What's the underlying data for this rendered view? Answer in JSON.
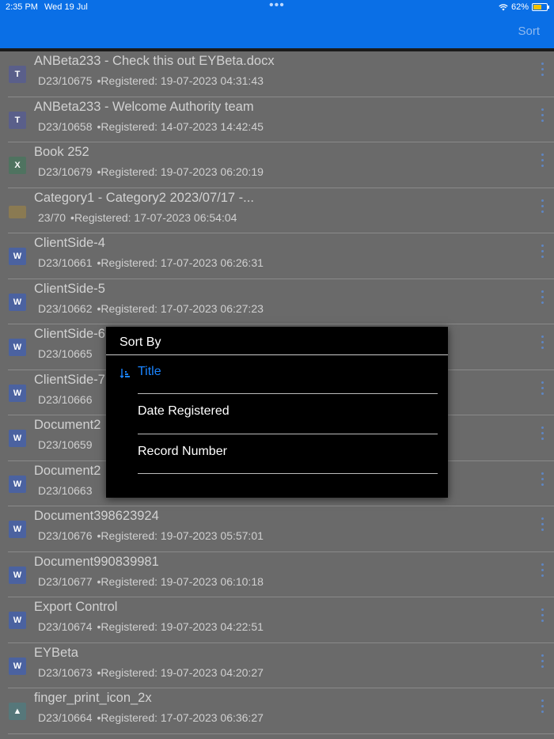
{
  "status": {
    "time": "2:35 PM",
    "date": "Wed 19 Jul",
    "dots": "•••",
    "battery": "62%"
  },
  "header": {
    "sort_label": "Sort"
  },
  "items": [
    {
      "title": "ANBeta233 - Check this out  EYBeta.docx",
      "number": "D23/10675",
      "registered": "•Registered: 19-07-2023 04:31:43",
      "icon": "teams-file-icon"
    },
    {
      "title": "ANBeta233 - Welcome Authority team",
      "number": "D23/10658",
      "registered": "•Registered: 14-07-2023 14:42:45",
      "icon": "teams-file-icon"
    },
    {
      "title": "Book 252",
      "number": "D23/10679",
      "registered": "•Registered: 19-07-2023 06:20:19",
      "icon": "excel-file-icon"
    },
    {
      "title": "Category1 - Category2 2023/07/17 -...",
      "number": "23/70",
      "registered": "•Registered: 17-07-2023 06:54:04",
      "icon": "folder-icon"
    },
    {
      "title": "ClientSide-4",
      "number": "D23/10661",
      "registered": "•Registered: 17-07-2023 06:26:31",
      "icon": "word-file-icon"
    },
    {
      "title": "ClientSide-5",
      "number": "D23/10662",
      "registered": "•Registered: 17-07-2023 06:27:23",
      "icon": "word-file-icon"
    },
    {
      "title": "ClientSide-6",
      "number": "D23/10665",
      "registered": "",
      "icon": "word-file-icon"
    },
    {
      "title": "ClientSide-7",
      "number": "D23/10666",
      "registered": "",
      "icon": "word-file-icon"
    },
    {
      "title": "Document2",
      "number": "D23/10659",
      "registered": "",
      "icon": "word-file-icon"
    },
    {
      "title": "Document2",
      "number": "D23/10663",
      "registered": "",
      "icon": "word-file-icon"
    },
    {
      "title": "Document398623924",
      "number": "D23/10676",
      "registered": "•Registered: 19-07-2023 05:57:01",
      "icon": "word-file-icon"
    },
    {
      "title": "Document990839981",
      "number": "D23/10677",
      "registered": "•Registered: 19-07-2023 06:10:18",
      "icon": "word-file-icon"
    },
    {
      "title": "Export Control",
      "number": "D23/10674",
      "registered": "•Registered: 19-07-2023 04:22:51",
      "icon": "word-file-icon"
    },
    {
      "title": "EYBeta",
      "number": "D23/10673",
      "registered": "•Registered: 19-07-2023 04:20:27",
      "icon": "word-file-icon"
    },
    {
      "title": "finger_print_icon_2x",
      "number": "D23/10664",
      "registered": "•Registered: 17-07-2023 06:36:27",
      "icon": "image-file-icon"
    }
  ],
  "sort_popup": {
    "heading": "Sort By",
    "options": [
      "Title",
      "Date Registered",
      "Record Number"
    ],
    "selected": "Title"
  },
  "colors": {
    "accent": "#0a6fe6",
    "selected_option": "#1a84ff"
  }
}
